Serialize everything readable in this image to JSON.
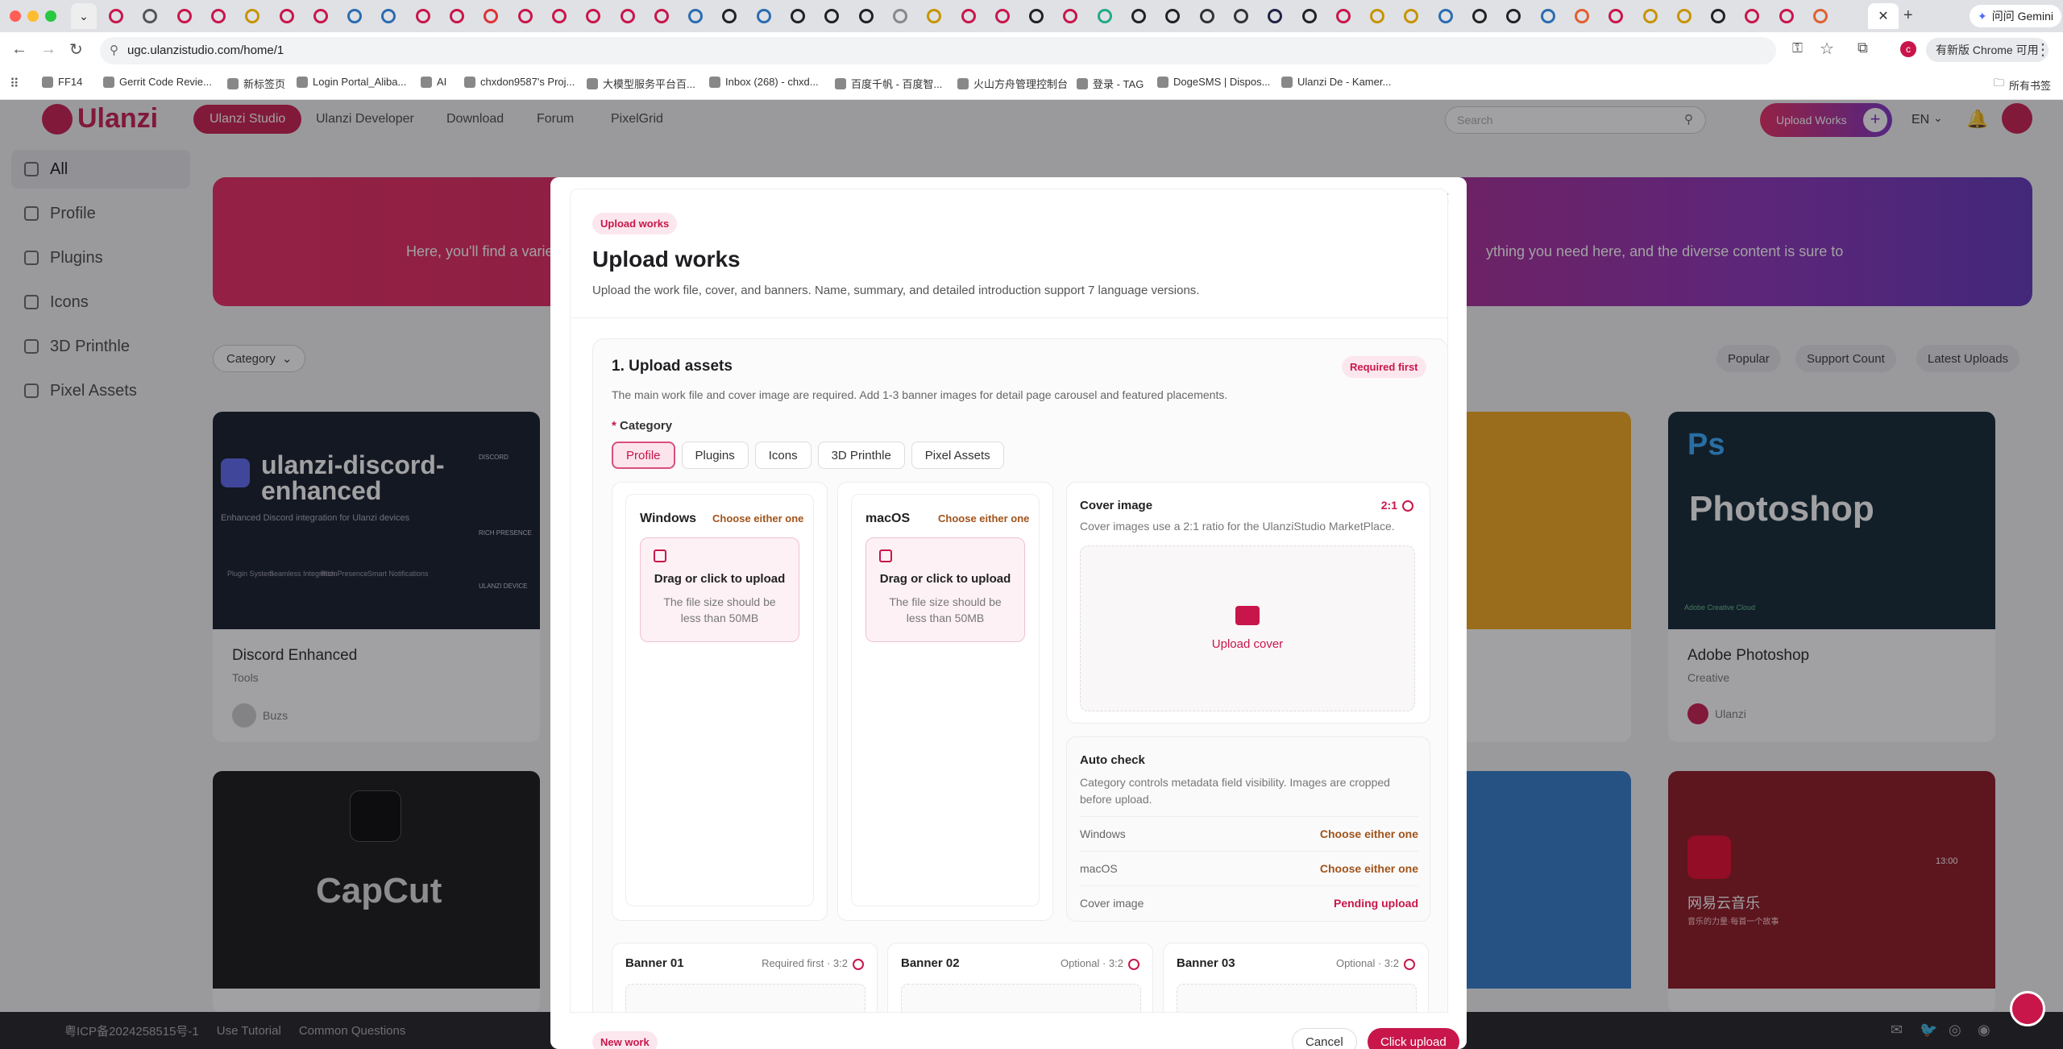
{
  "browser": {
    "url": "ugc.ulanzistudio.com/home/1",
    "gemini": "问问 Gemini",
    "chrome_notice": "有新版 Chrome 可用",
    "profile_initial": "c",
    "all_bookmarks": "所有书签",
    "bookmarks": [
      "FF14",
      "Gerrit Code Revie...",
      "新标签页",
      "Login Portal_Aliba...",
      "AI",
      "chxdon9587's Proj...",
      "大模型服务平台百...",
      "Inbox (268) - chxd...",
      "百度千帆 - 百度智...",
      "火山方舟管理控制台",
      "登录 - TAG",
      "DogeSMS | Dispos...",
      "Ulanzi De - Kamer..."
    ]
  },
  "site": {
    "logo_text": "Ulanzi",
    "nav": [
      "Ulanzi Studio",
      "Ulanzi Developer",
      "Download",
      "Forum",
      "PixelGrid"
    ],
    "search_placeholder": "Search",
    "upload_works_label": "Upload Works",
    "lang": "EN",
    "sidebar": [
      "All",
      "Profile",
      "Plugins",
      "Icons",
      "3D Printhle",
      "Pixel Assets"
    ],
    "banner_text_left": "Here, you'll find a variet",
    "banner_text_right": "ything you need here, and the diverse content is sure to",
    "category_filter": "Category",
    "sort_tabs": [
      "Popular",
      "Support Count",
      "Latest Uploads"
    ],
    "cards": [
      {
        "title": "Discord Enhanced",
        "category": "Tools",
        "author": "Buzs",
        "art_title": "ulanzi-discord-enhanced",
        "art_sub": "Enhanced Discord integration for Ulanzi devices",
        "art_features": [
          "Plugin System",
          "Seamless Integration",
          "Rich Presence",
          "Smart Notifications"
        ],
        "art_side": [
          "DISCORD",
          "RICH PRESENCE",
          "ULANZI DEVICE"
        ]
      },
      {
        "title": "Adobe Photoshop",
        "category": "Creative",
        "author": "Ulanzi",
        "art_title": "Photoshop",
        "art_sub": "Adobe Creative Cloud"
      },
      {
        "title": "CapCut",
        "art_title": "CapCut"
      },
      {
        "title": "网易云音乐",
        "art_title": "网易云音乐",
        "art_sub": "音乐的力量·每首一个故事",
        "art_time": "13:00"
      }
    ],
    "footer": [
      "粤ICP备2024258515号-1",
      "Use Tutorial",
      "Common Questions"
    ]
  },
  "modal": {
    "tag": "Upload works",
    "title": "Upload works",
    "subtitle": "Upload the work file, cover, and banners. Name, summary, and detailed introduction support 7 language versions.",
    "section_title": "1. Upload assets",
    "required_first": "Required first",
    "section_desc": "The main work file and cover image are required. Add 1-3 banner images for detail page carousel and featured placements.",
    "category_label": "Category",
    "categories": [
      "Profile",
      "Plugins",
      "Icons",
      "3D Printhle",
      "Pixel Assets"
    ],
    "active_category": "Profile",
    "windows": {
      "label": "Windows",
      "note": "Choose either one",
      "drop": "Drag or click to upload",
      "size": "The file size should be less than 50MB"
    },
    "macos": {
      "label": "macOS",
      "note": "Choose either one",
      "drop": "Drag or click to upload",
      "size": "The file size should be less than 50MB"
    },
    "cover": {
      "label": "Cover image",
      "ratio": "2:1",
      "desc": "Cover images use a 2:1 ratio for the UlanziStudio MarketPlace.",
      "upload": "Upload cover"
    },
    "autocheck": {
      "title": "Auto check",
      "desc": "Category controls metadata field visibility. Images are cropped before upload.",
      "rows": [
        {
          "label": "Windows",
          "status": "Choose either one"
        },
        {
          "label": "macOS",
          "status": "Choose either one"
        },
        {
          "label": "Cover image",
          "status": "Pending upload"
        }
      ]
    },
    "banners": [
      {
        "label": "Banner 01",
        "meta": "Required first · 3:2"
      },
      {
        "label": "Banner 02",
        "meta": "Optional · 3:2"
      },
      {
        "label": "Banner 03",
        "meta": "Optional · 3:2"
      }
    ],
    "footer_tag": "New work",
    "cancel": "Cancel",
    "submit": "Click upload"
  },
  "colors": {
    "accent": "#c8164b",
    "brown": "#a1531a",
    "banner_start": "#e8245e",
    "banner_end": "#5d2fb8"
  }
}
